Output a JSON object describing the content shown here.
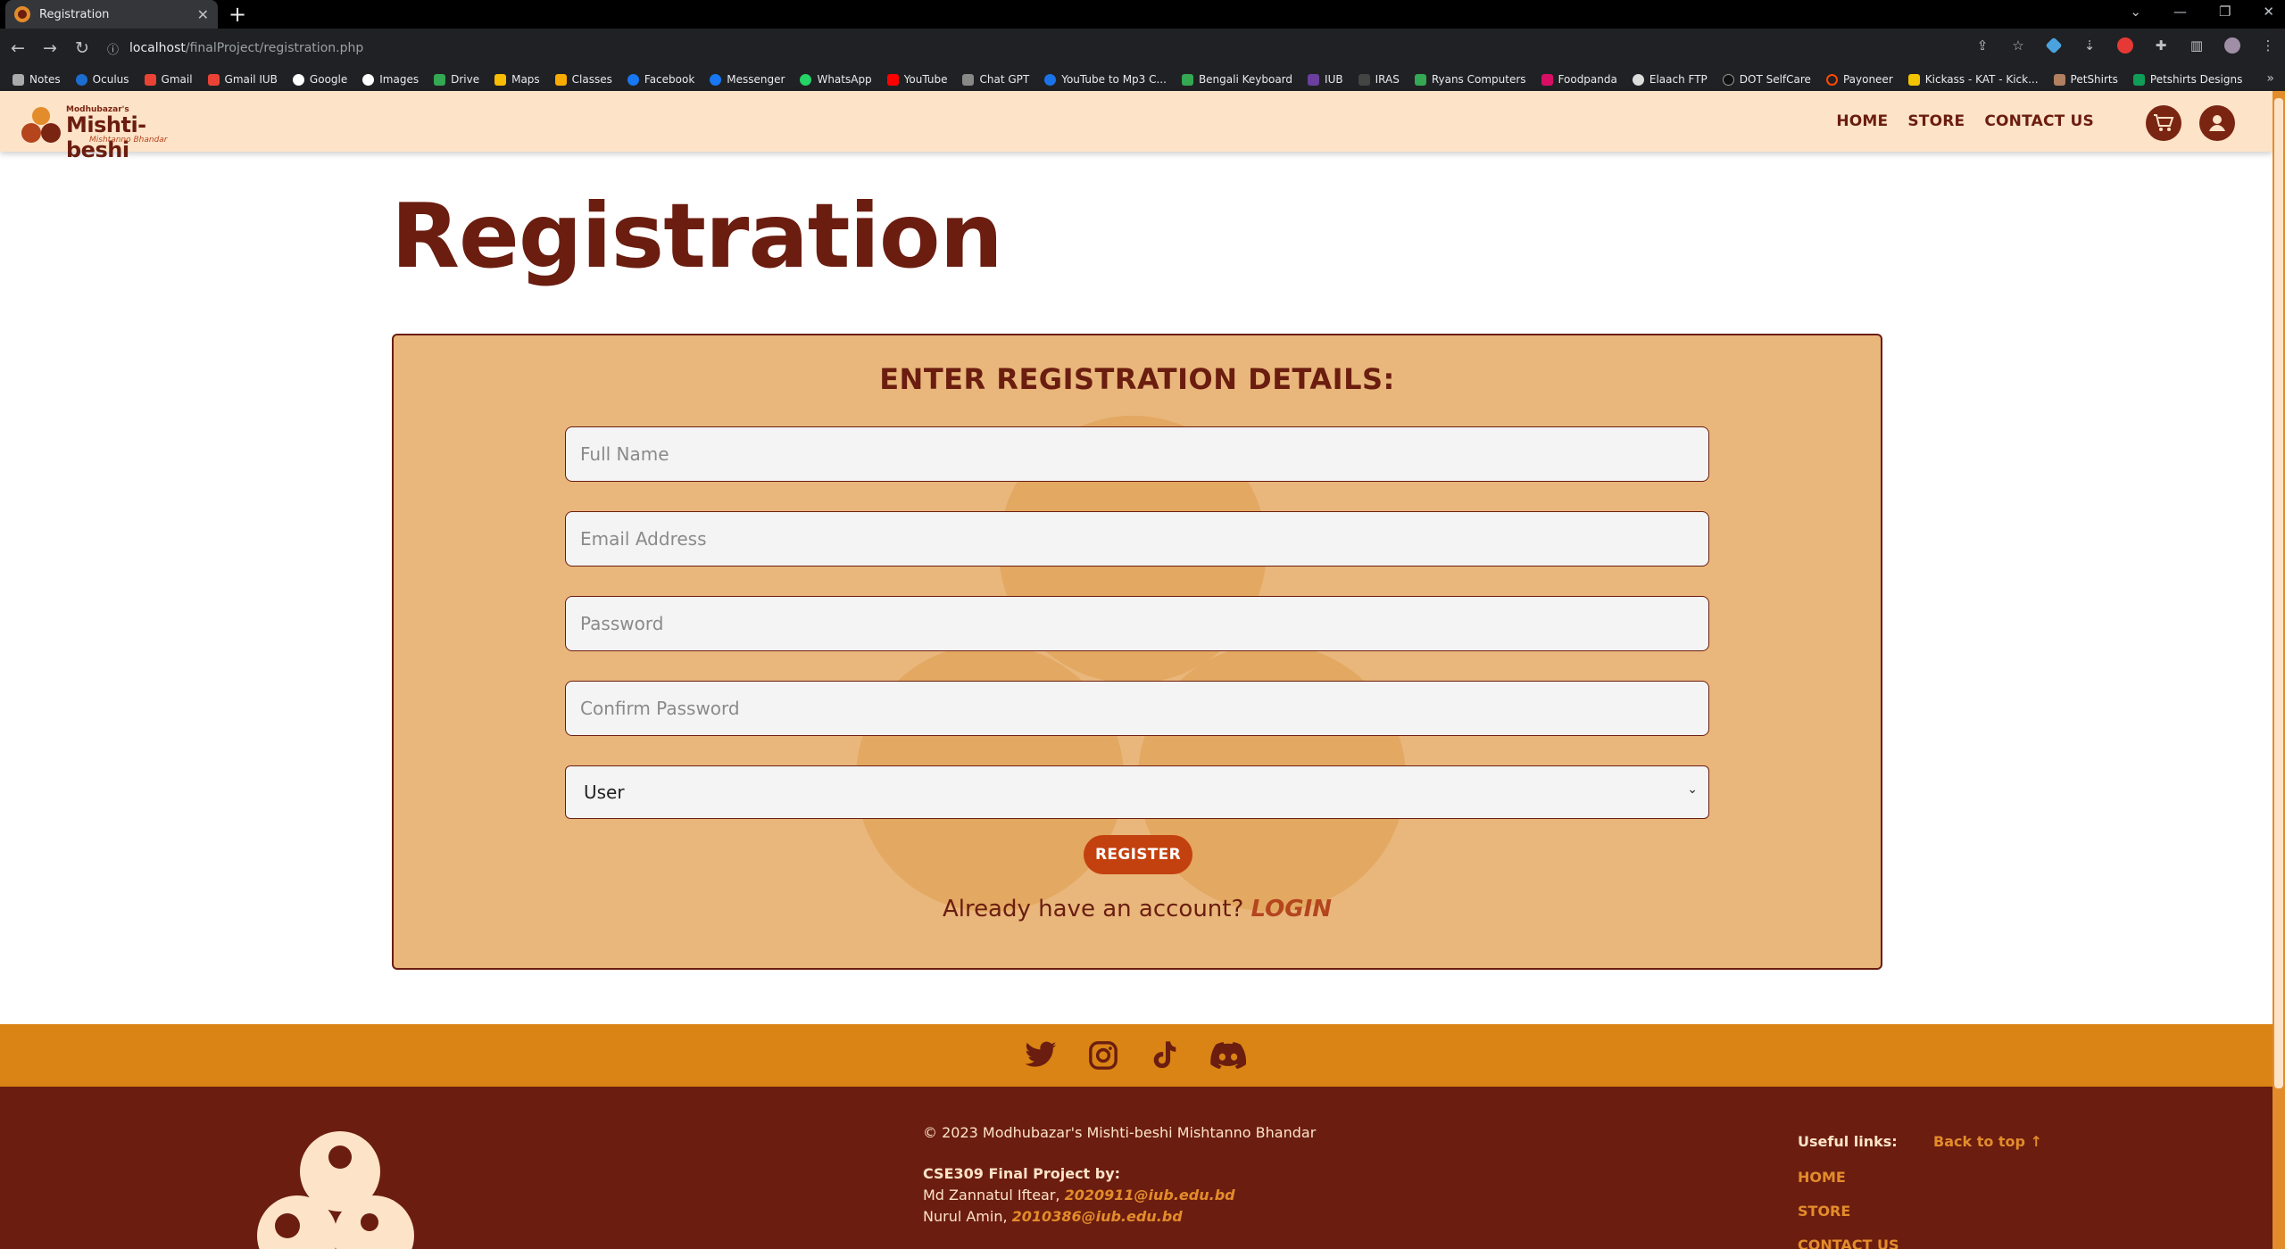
{
  "browser": {
    "tab_title": "Registration",
    "url_host": "localhost",
    "url_path": "/finalProject/registration.php",
    "bookmarks": [
      "Notes",
      "Oculus",
      "Gmail",
      "Gmail IUB",
      "Google",
      "Images",
      "Drive",
      "Maps",
      "Classes",
      "Facebook",
      "Messenger",
      "WhatsApp",
      "YouTube",
      "Chat GPT",
      "YouTube to Mp3 C...",
      "Bengali Keyboard",
      "IUB",
      "IRAS",
      "Ryans Computers",
      "Foodpanda",
      "Elaach FTP",
      "DOT SelfCare",
      "Payoneer",
      "Kickass - KAT - Kick...",
      "PetShirts",
      "Petshirts Designs"
    ]
  },
  "site": {
    "logo_small": "Modhubazar's",
    "logo_main": "Mishti-beshi",
    "logo_sub": "Mishtanno Bhandar",
    "nav": {
      "home": "HOME",
      "store": "STORE",
      "contact": "CONTACT US"
    }
  },
  "page": {
    "title": "Registration",
    "form": {
      "heading": "ENTER REGISTRATION DETAILS:",
      "full_name_placeholder": "Full Name",
      "email_placeholder": "Email Address",
      "password_placeholder": "Password",
      "confirm_password_placeholder": "Confirm Password",
      "role_selected": "User",
      "register_label": "REGISTER",
      "login_prompt": "Already have an account?",
      "login_label": "LOGIN"
    }
  },
  "footer": {
    "copyright": "© 2023 Modhubazar's Mishti-beshi Mishtanno Bhandar",
    "project_by": "CSE309 Final Project by:",
    "author1_name": "Md Zannatul Iftear,",
    "author1_email": "2020911@iub.edu.bd",
    "author2_name": "Nurul Amin,",
    "author2_email": "2010386@iub.edu.bd",
    "useful_links_label": "Useful links:",
    "back_to_top": "Back to top ↑",
    "links": {
      "home": "HOME",
      "store": "STORE",
      "contact": "CONTACT US"
    }
  },
  "colors": {
    "brand_dark": "#6b1d10",
    "brand_orange": "#d98414",
    "card_bg": "#e9b77c",
    "nav_bg": "#fde3c8",
    "button": "#c3410f"
  }
}
